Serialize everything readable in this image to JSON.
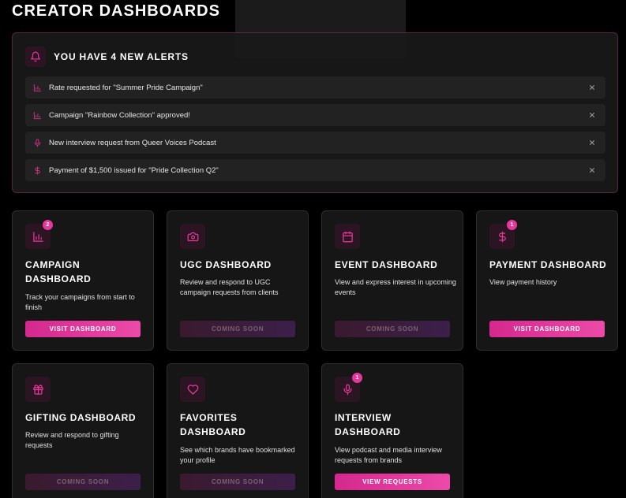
{
  "page": {
    "title": "CREATOR DASHBOARDS"
  },
  "alerts": {
    "title": "YOU HAVE 4 NEW ALERTS",
    "items": [
      {
        "icon": "bar-chart-icon",
        "text": "Rate requested for \"Summer Pride Campaign\""
      },
      {
        "icon": "bar-chart-icon",
        "text": "Campaign \"Rainbow Collection\" approved!"
      },
      {
        "icon": "microphone-icon",
        "text": "New interview request from Queer Voices Podcast"
      },
      {
        "icon": "dollar-icon",
        "text": "Payment of $1,500 issued for \"Pride Collection Q2\""
      }
    ]
  },
  "colors": {
    "accent": "#e6389a",
    "card_bg": "#161616",
    "alert_border": "#5a2340"
  },
  "dashboards": [
    {
      "name": "CAMPAIGN DASHBOARD",
      "desc": "Track your campaigns from start to finish",
      "button": "VISIT DASHBOARD",
      "badge": "2",
      "icon": "bar-chart-icon",
      "enabled": true
    },
    {
      "name": "UGC DASHBOARD",
      "desc": "Review and respond to UGC campaign requests from clients",
      "button": "COMING SOON",
      "badge": "",
      "icon": "camera-icon",
      "enabled": false
    },
    {
      "name": "EVENT DASHBOARD",
      "desc": "View and express interest in upcoming events",
      "button": "COMING SOON",
      "badge": "",
      "icon": "calendar-icon",
      "enabled": false
    },
    {
      "name": "PAYMENT DASHBOARD",
      "desc": "View payment history",
      "button": "VISIT DASHBOARD",
      "badge": "1",
      "icon": "dollar-icon",
      "enabled": true
    },
    {
      "name": "GIFTING DASHBOARD",
      "desc": "Review and respond to gifting requests",
      "button": "COMING SOON",
      "badge": "",
      "icon": "gift-icon",
      "enabled": false
    },
    {
      "name": "FAVORITES DASHBOARD",
      "desc": "See which brands have bookmarked your profile",
      "button": "COMING SOON",
      "badge": "",
      "icon": "heart-icon",
      "enabled": false
    },
    {
      "name": "INTERVIEW DASHBOARD",
      "desc": "View podcast and media interview requests from brands",
      "button": "VIEW REQUESTS",
      "badge": "1",
      "icon": "microphone-icon",
      "enabled": true
    }
  ]
}
